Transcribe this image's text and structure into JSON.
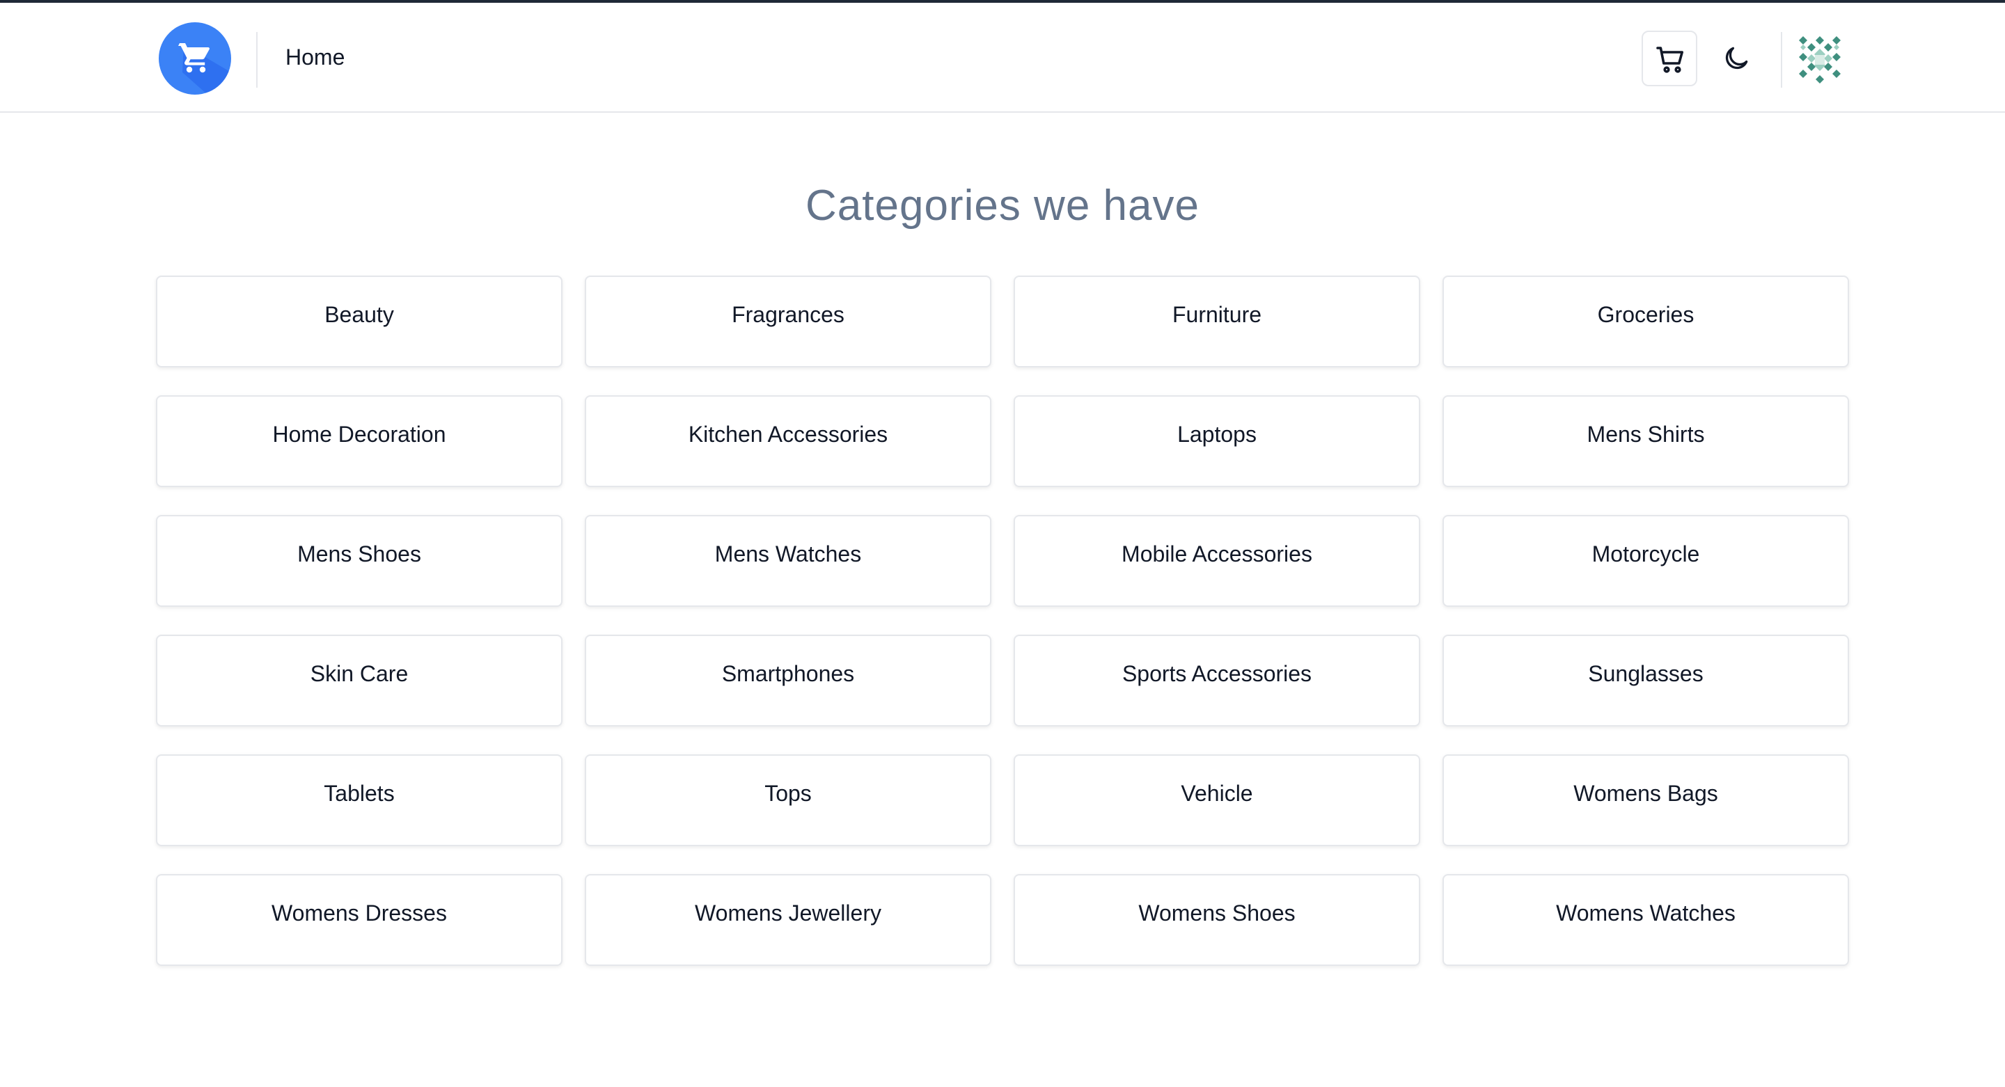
{
  "header": {
    "nav_label": "Home",
    "brand_color": "#3b82f6",
    "logo_icon": "shopping-cart-icon",
    "cart_icon": "cart-icon",
    "theme_icon": "moon-icon",
    "avatar_icon": "identicon-avatar"
  },
  "main": {
    "title": "Categories we have",
    "categories": [
      {
        "label": "Beauty"
      },
      {
        "label": "Fragrances"
      },
      {
        "label": "Furniture"
      },
      {
        "label": "Groceries"
      },
      {
        "label": "Home Decoration"
      },
      {
        "label": "Kitchen Accessories"
      },
      {
        "label": "Laptops"
      },
      {
        "label": "Mens Shirts"
      },
      {
        "label": "Mens Shoes"
      },
      {
        "label": "Mens Watches"
      },
      {
        "label": "Mobile Accessories"
      },
      {
        "label": "Motorcycle"
      },
      {
        "label": "Skin Care"
      },
      {
        "label": "Smartphones"
      },
      {
        "label": "Sports Accessories"
      },
      {
        "label": "Sunglasses"
      },
      {
        "label": "Tablets"
      },
      {
        "label": "Tops"
      },
      {
        "label": "Vehicle"
      },
      {
        "label": "Womens Bags"
      },
      {
        "label": "Womens Dresses"
      },
      {
        "label": "Womens Jewellery"
      },
      {
        "label": "Womens Shoes"
      },
      {
        "label": "Womens Watches"
      }
    ]
  }
}
